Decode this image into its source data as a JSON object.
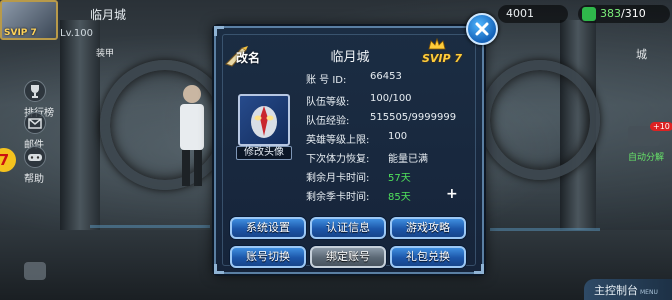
{
  "hud": {
    "player_name": "临月城",
    "vip_badge": "SVIP 7",
    "level": "Lv.100",
    "gold": "4001",
    "energy_current": "383",
    "energy_max": "/310",
    "side_hint": "装甲",
    "right_hint": "城"
  },
  "left_menu": {
    "items": [
      {
        "label": "排行榜"
      },
      {
        "label": "邮件"
      },
      {
        "label": "帮助"
      }
    ],
    "badge": "7"
  },
  "right_menu": {
    "auto_decompose_label": "自动分解",
    "auto_badge": "+10",
    "main_console_label": "主控制台",
    "main_console_sub": "MENU"
  },
  "modal": {
    "title": "临月城",
    "rename_label": "改名",
    "svip": "SVIP 7",
    "avatar_caption": "修改头像",
    "rows": [
      {
        "label": "账 号 ID:",
        "value": "66453",
        "green": false
      },
      {
        "label": "队伍等级:",
        "value": "100/100",
        "green": false
      },
      {
        "label": "队伍经验:",
        "value": "515505/9999999",
        "green": false
      },
      {
        "label": "英雄等级上限:",
        "value": "100",
        "green": false
      },
      {
        "label": "下次体力恢复:",
        "value": "能量已满",
        "green": false
      },
      {
        "label": "剩余月卡时间:",
        "value": "57天",
        "green": true
      },
      {
        "label": "剩余季卡时间:",
        "value": "85天",
        "green": true
      }
    ],
    "plus": "+",
    "buttons": [
      {
        "label": "系统设置",
        "style": "blue"
      },
      {
        "label": "认证信息",
        "style": "blue"
      },
      {
        "label": "游戏攻略",
        "style": "blue"
      },
      {
        "label": "账号切换",
        "style": "blue"
      },
      {
        "label": "绑定账号",
        "style": "gray"
      },
      {
        "label": "礼包兑换",
        "style": "blue"
      }
    ]
  },
  "colors": {
    "panel_bg": "#1b2d43",
    "panel_border": "#5a7fa3",
    "button_blue": "#2a6fc6",
    "button_gray": "#6b7885",
    "value_green": "#50e25c",
    "svip_gold": "#ffcc3a"
  },
  "icons": [
    "close-icon",
    "quill-icon",
    "crown-icon",
    "trophy-icon",
    "mail-icon",
    "gamepad-icon",
    "chat-icon",
    "energy-icon"
  ]
}
